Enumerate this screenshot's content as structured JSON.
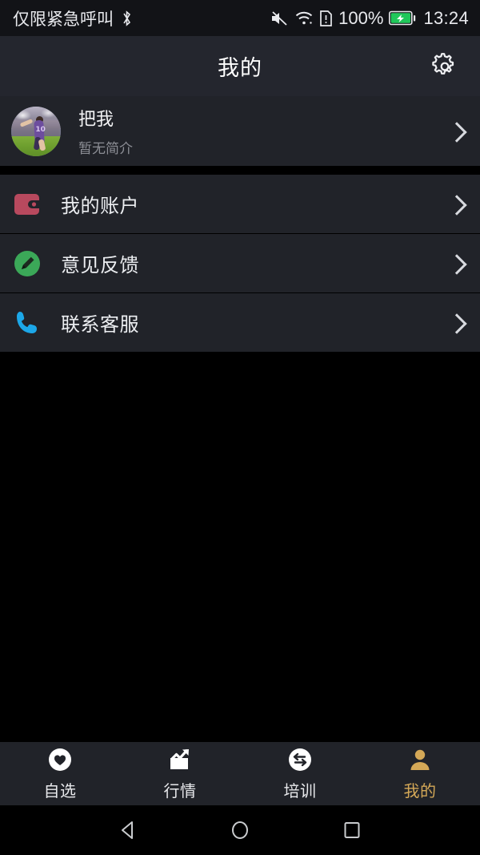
{
  "statusbar": {
    "carrier": "仅限紧急呼叫",
    "bluetooth_icon": "bluetooth-icon",
    "mute_icon": "mute-icon",
    "wifi_icon": "wifi-icon",
    "sim_icon": "sim-alert-icon",
    "battery_percent": "100%",
    "battery_icon": "battery-charging-icon",
    "time": "13:24"
  },
  "header": {
    "title": "我的",
    "settings_icon": "gear-icon"
  },
  "profile": {
    "avatar_icon": "avatar",
    "name": "把我",
    "subtitle": "暂无简介",
    "chevron_icon": "chevron-right-icon"
  },
  "menu": {
    "items": [
      {
        "label": "我的账户",
        "icon": "wallet-icon",
        "icon_color": "#b8495e",
        "chevron_icon": "chevron-right-icon"
      },
      {
        "label": "意见反馈",
        "icon": "pencil-circle-icon",
        "icon_color": "#3ba858",
        "chevron_icon": "chevron-right-icon"
      },
      {
        "label": "联系客服",
        "icon": "phone-icon",
        "icon_color": "#1ca7e8",
        "chevron_icon": "chevron-right-icon"
      }
    ]
  },
  "tabbar": {
    "active_color": "#d4a857",
    "inactive_color": "#e8e9ec",
    "tabs": [
      {
        "label": "自选",
        "icon": "heart-circle-icon",
        "active": false
      },
      {
        "label": "行情",
        "icon": "chart-trend-icon",
        "active": false
      },
      {
        "label": "培训",
        "icon": "swap-circle-icon",
        "active": false
      },
      {
        "label": "我的",
        "icon": "person-icon",
        "active": true
      }
    ]
  },
  "navbar": {
    "back_icon": "back-triangle-icon",
    "home_icon": "home-circle-icon",
    "recents_icon": "recents-square-icon"
  },
  "theme": {
    "screen_bg": "#000000",
    "row_bg": "#212329",
    "titlebar_bg": "#24262e",
    "statusbar_bg": "#121317",
    "text_primary": "#eceef1",
    "text_secondary": "#8c8e95"
  }
}
